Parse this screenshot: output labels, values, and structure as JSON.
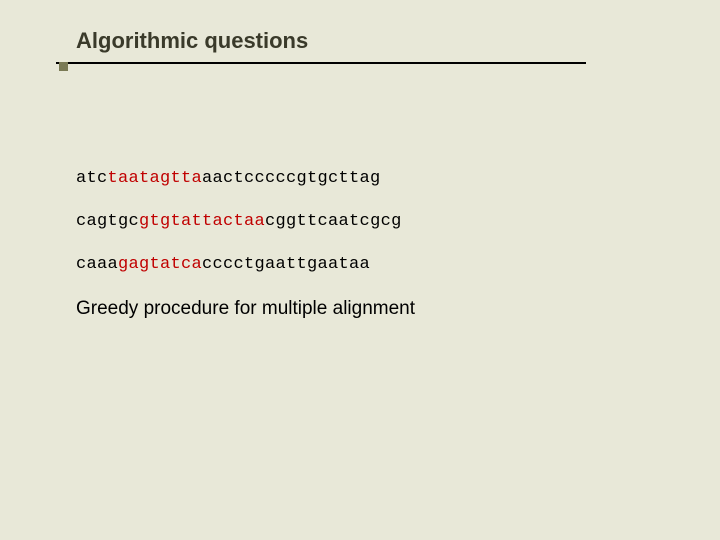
{
  "title": "Algorithmic questions",
  "sequences": [
    {
      "pre": "atc",
      "hl": "taatagtta",
      "post": "aactcccccgtgcttag"
    },
    {
      "pre": "cagtgc",
      "hl": "gtgtattactaa",
      "post": "cggttcaatcgcg"
    },
    {
      "pre": "caaa",
      "hl": "gagtatca",
      "post": "cccctgaattgaataa"
    }
  ],
  "description": "Greedy procedure for multiple alignment"
}
